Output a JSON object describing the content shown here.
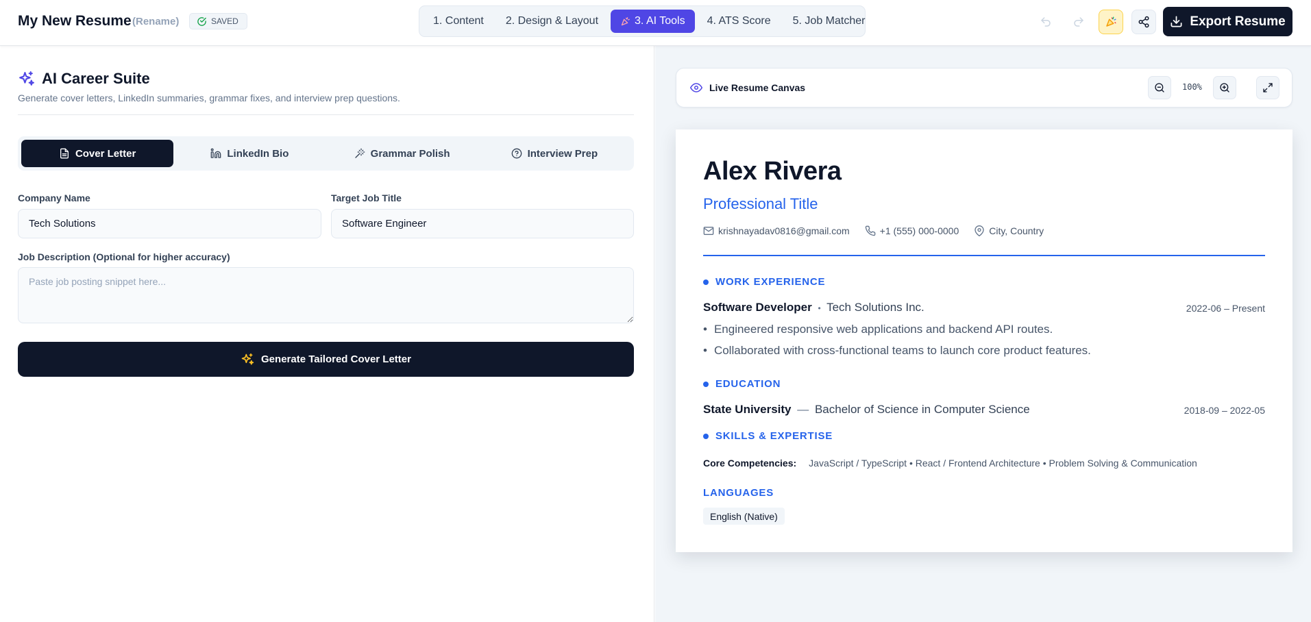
{
  "header": {
    "doc_title": "My New Resume",
    "rename_label": "(Rename)",
    "saved_label": "SAVED",
    "steps": [
      {
        "label": "1. Content"
      },
      {
        "label": "2. Design & Layout"
      },
      {
        "label": "3. AI Tools"
      },
      {
        "label": "4. ATS Score"
      },
      {
        "label": "5. Job Matcher"
      }
    ],
    "active_step": 2,
    "export_label": "Export Resume"
  },
  "ai_suite": {
    "title": "AI Career Suite",
    "subtitle": "Generate cover letters, LinkedIn summaries, grammar fixes, and interview prep questions.",
    "tabs": [
      {
        "label": "Cover Letter",
        "icon": "document-icon"
      },
      {
        "label": "LinkedIn Bio",
        "icon": "linkedin-icon"
      },
      {
        "label": "Grammar Polish",
        "icon": "magic-wand-icon"
      },
      {
        "label": "Interview Prep",
        "icon": "help-circle-icon"
      }
    ],
    "active_tab": 0,
    "company_label": "Company Name",
    "company_value": "Tech Solutions",
    "job_title_label": "Target Job Title",
    "job_title_value": "Software Engineer",
    "job_desc_label": "Job Description (Optional for higher accuracy)",
    "job_desc_placeholder": "Paste job posting snippet here...",
    "generate_label": "Generate Tailored Cover Letter"
  },
  "canvas": {
    "label": "Live Resume Canvas",
    "zoom": "100%"
  },
  "resume": {
    "name": "Alex Rivera",
    "title": "Professional Title",
    "email": "krishnayadav0816@gmail.com",
    "phone": "+1 (555) 000-0000",
    "location": "City, Country",
    "experience_heading": "WORK EXPERIENCE",
    "experience": {
      "role": "Software Developer",
      "separator": "•",
      "company": "Tech Solutions Inc.",
      "dates": "2022-06 – Present",
      "bullets": [
        "Engineered responsive web applications and backend API routes.",
        "Collaborated with cross-functional teams to launch core product features."
      ]
    },
    "education_heading": "EDUCATION",
    "education": {
      "school": "State University",
      "separator": "—",
      "degree": "Bachelor of Science in Computer Science",
      "dates": "2018-09 – 2022-05"
    },
    "skills_heading": "SKILLS & EXPERTISE",
    "skills_label": "Core Competencies:",
    "skills_value": "JavaScript / TypeScript • React / Frontend Architecture • Problem Solving & Communication",
    "languages_heading": "LANGUAGES",
    "language": "English (Native)"
  },
  "colors": {
    "accent": "#4f46e5",
    "resume_blue": "#2563eb",
    "dark": "#0f172a"
  }
}
